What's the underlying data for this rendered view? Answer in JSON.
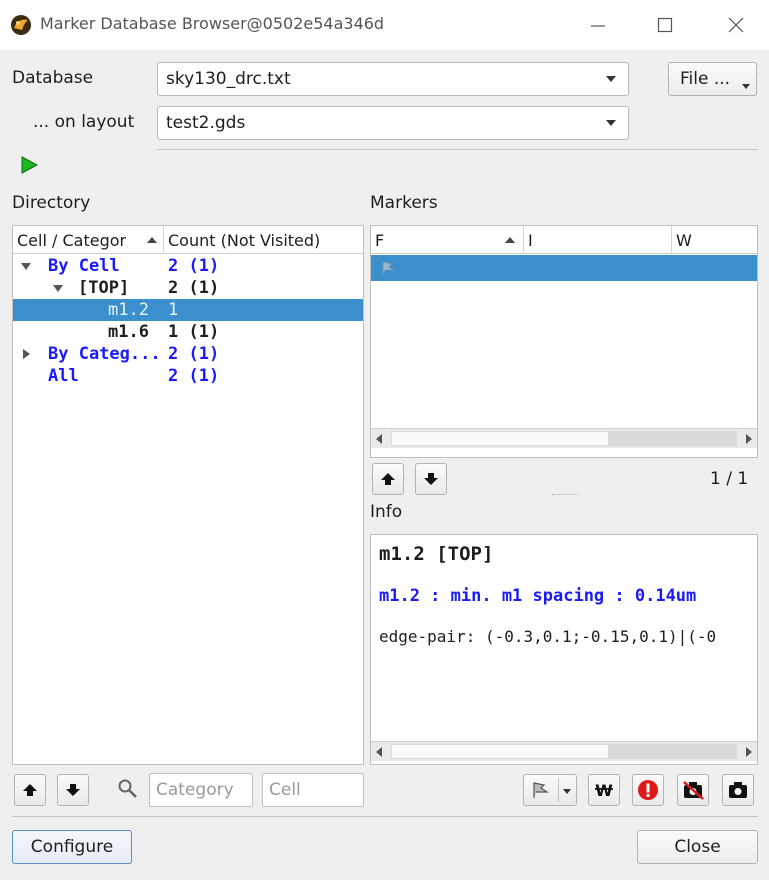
{
  "window": {
    "title": "Marker Database Browser@0502e54a346d",
    "icon": "klayout-logo-icon"
  },
  "database": {
    "label": "Database",
    "value": "sky130_drc.txt",
    "file_button": "File ..."
  },
  "layout": {
    "label": "... on layout",
    "value": "test2.gds"
  },
  "directory": {
    "label": "Directory",
    "columns": [
      "Cell / Categor",
      "Count (Not Visited)"
    ],
    "rows": [
      {
        "name": "By Cell",
        "count": "2 (1)"
      },
      {
        "name": "[TOP]",
        "count": "2 (1)"
      },
      {
        "name": "m1.2",
        "count": "1"
      },
      {
        "name": "m1.6",
        "count": "1 (1)"
      },
      {
        "name": "By Categ...",
        "count": "2 (1)"
      },
      {
        "name": "All",
        "count": "2 (1)"
      }
    ],
    "filter_category_placeholder": "Category",
    "filter_cell_placeholder": "Cell"
  },
  "markers": {
    "label": "Markers",
    "columns": [
      "F",
      "I",
      "W"
    ],
    "counter": "1 / 1"
  },
  "info": {
    "label": "Info",
    "title": "m1.2 [TOP]",
    "category": "m1.2 : min. m1 spacing : 0.14um",
    "geometry": "edge-pair: (-0.3,0.1;-0.15,0.1)|(-0"
  },
  "buttons": {
    "configure": "Configure",
    "close": "Close"
  },
  "colors": {
    "selection": "#3a8fcc",
    "link_blue": "#1a1aff",
    "run_green": "#1fb81f",
    "error_red": "#e01818"
  }
}
